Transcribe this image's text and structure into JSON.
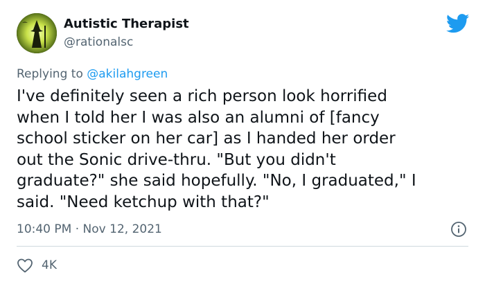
{
  "author": {
    "name": "Autistic Therapist",
    "handle": "@rationalsc"
  },
  "reply": {
    "prefix": "Replying to ",
    "mention": "@akilahgreen"
  },
  "tweet": {
    "lines": [
      "I've definitely seen a rich person look horrified",
      "when I told her I was also an alumni of [fancy",
      "school sticker on her car] as I handed her order",
      "out the Sonic drive-thru. \"But you didn't",
      "graduate?\" she said hopefully. \"No, I graduated,\" I",
      "said. \"Need ketchup with that?\""
    ],
    "time": "10:40 PM",
    "separator": "·",
    "date": "Nov 12, 2021"
  },
  "stats": {
    "likes": "4K"
  },
  "icons": {
    "brand": "twitter-bird-icon",
    "info": "info-icon",
    "like": "heart-icon"
  },
  "colors": {
    "brand_blue": "#1d9bf0",
    "secondary_text": "#536471",
    "divider": "#cfd9de"
  }
}
